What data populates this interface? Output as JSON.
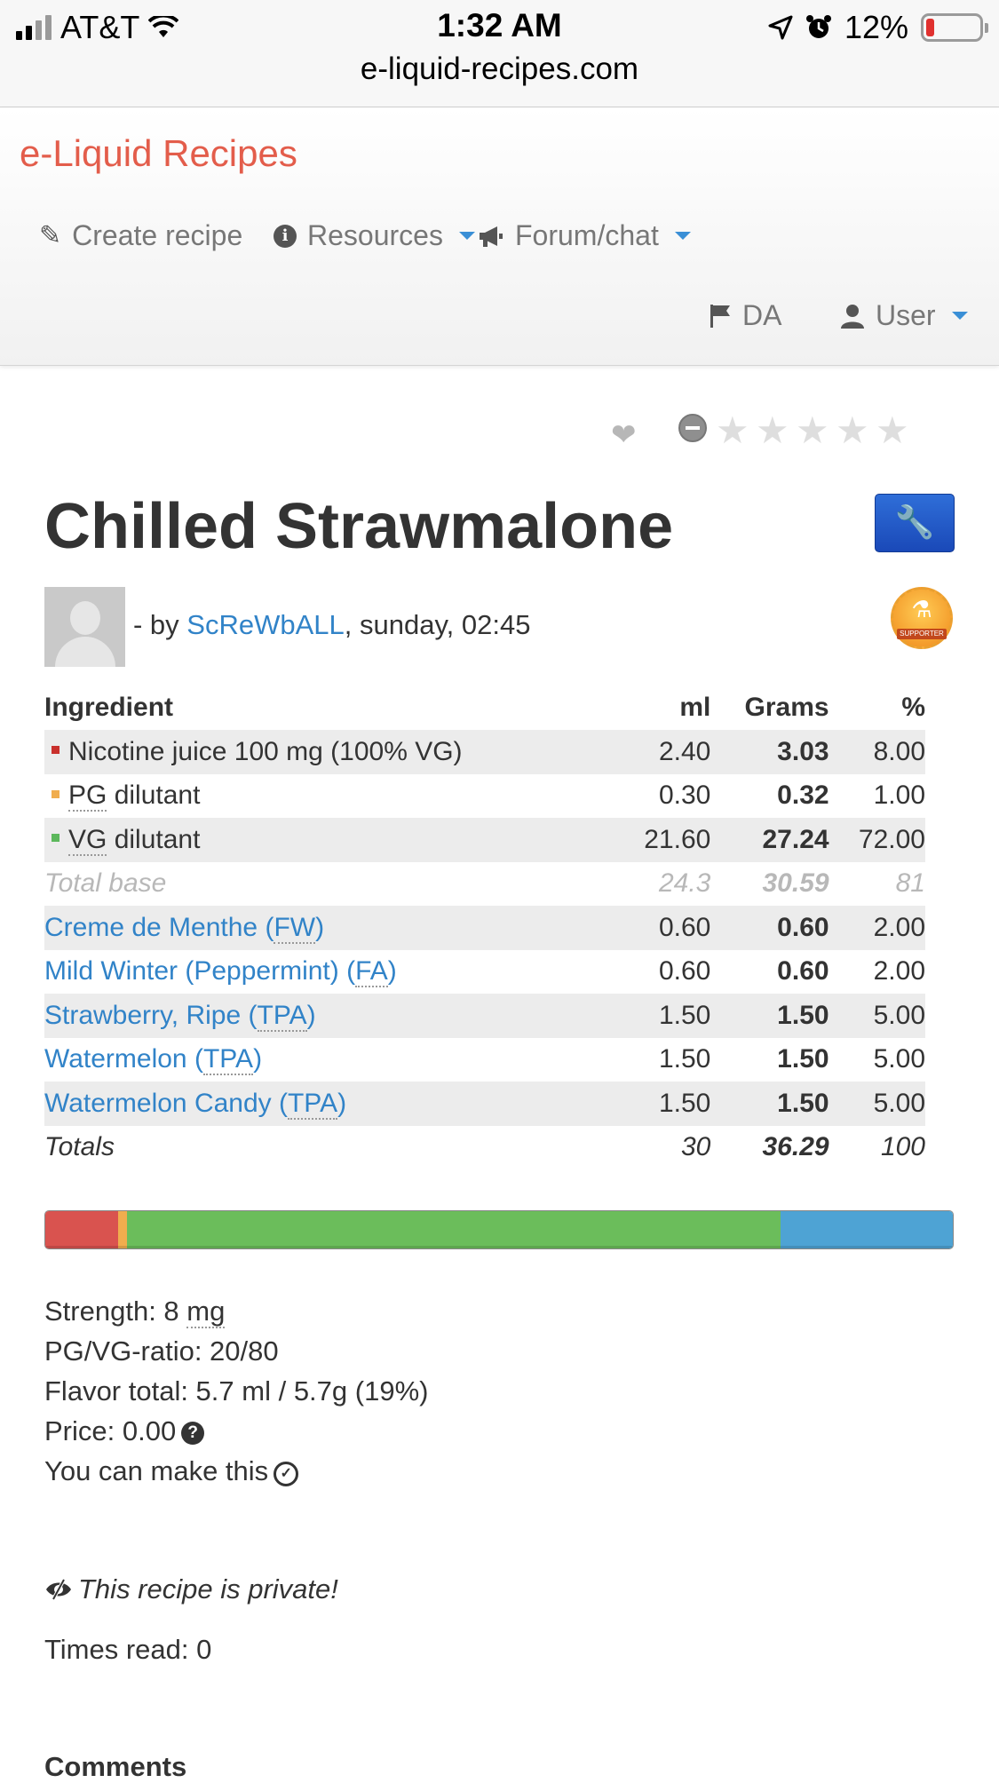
{
  "status_bar": {
    "carrier": "AT&T",
    "time": "1:32 AM",
    "battery": "12%",
    "url": "e-liquid-recipes.com"
  },
  "navbar": {
    "brand": "e-Liquid Recipes",
    "create_recipe": "Create recipe",
    "resources": "Resources",
    "forum": "Forum/chat",
    "language": "DA",
    "user": "User"
  },
  "recipe": {
    "title": "Chilled Strawmalone",
    "by_prefix": "- by ",
    "author": "ScReWbALL",
    "date_suffix": ", sunday, 02:45",
    "badge_text": "SUPPORTER"
  },
  "table": {
    "headers": [
      "Ingredient",
      "ml",
      "Grams",
      "%"
    ],
    "base_rows": [
      {
        "name": "Nicotine juice 100 mg (100% VG)",
        "ml": "2.40",
        "grams": "3.03",
        "pct": "8.00",
        "color": "#c9302c"
      },
      {
        "pre": "PG",
        "name": " dilutant",
        "ml": "0.30",
        "grams": "0.32",
        "pct": "1.00",
        "color": "#f0ad4e"
      },
      {
        "pre": "VG",
        "name": " dilutant",
        "ml": "21.60",
        "grams": "27.24",
        "pct": "72.00",
        "color": "#5cb85c"
      }
    ],
    "total_base": {
      "label": "Total base",
      "ml": "24.3",
      "grams": "30.59",
      "pct": "81"
    },
    "flavors": [
      {
        "name": "Creme de Menthe (",
        "abbr": "FW",
        "end": ")",
        "ml": "0.60",
        "grams": "0.60",
        "pct": "2.00"
      },
      {
        "name": "Mild Winter (Peppermint) (",
        "abbr": "FA",
        "end": ")",
        "ml": "0.60",
        "grams": "0.60",
        "pct": "2.00"
      },
      {
        "name": "Strawberry, Ripe (",
        "abbr": "TPA",
        "end": ")",
        "ml": "1.50",
        "grams": "1.50",
        "pct": "5.00"
      },
      {
        "name": "Watermelon (",
        "abbr": "TPA",
        "end": ")",
        "ml": "1.50",
        "grams": "1.50",
        "pct": "5.00"
      },
      {
        "name": "Watermelon Candy (",
        "abbr": "TPA",
        "end": ")",
        "ml": "1.50",
        "grams": "1.50",
        "pct": "5.00"
      }
    ],
    "totals": {
      "label": "Totals",
      "ml": "30",
      "grams": "36.29",
      "pct": "100"
    }
  },
  "composition_bar": [
    {
      "part": "nicotine",
      "pct": 8,
      "color": "#d9534f"
    },
    {
      "part": "pg",
      "pct": 1,
      "color": "#f0ad4e"
    },
    {
      "part": "vg",
      "pct": 72,
      "color": "#6bbd5b"
    },
    {
      "part": "flavor",
      "pct": 19,
      "color": "#4ea3d4"
    }
  ],
  "info": {
    "strength_label": "Strength: 8 ",
    "strength_unit": "mg",
    "ratio": "PG/VG-ratio: 20/80",
    "flavor_total": "Flavor total: 5.7 ml / 5.7g (19%)",
    "price": "Price: 0.00",
    "make": "You can make this",
    "private": "This recipe is private!",
    "times_read": "Times read: 0",
    "comments_heading": "Comments"
  }
}
